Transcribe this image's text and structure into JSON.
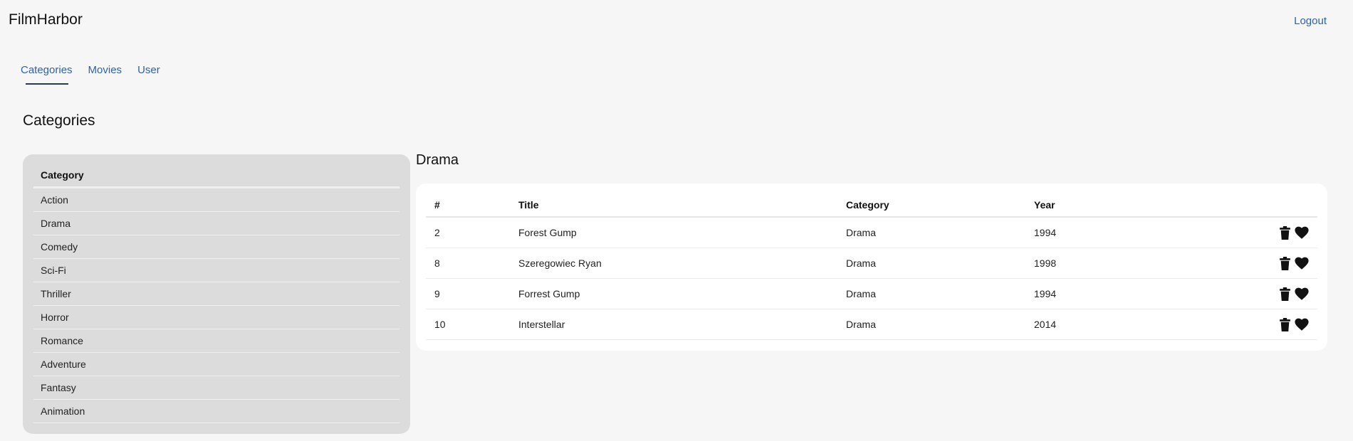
{
  "app": {
    "brand": "FilmHarbor",
    "logout_label": "Logout"
  },
  "nav": {
    "tabs": [
      {
        "label": "Categories",
        "active": true
      },
      {
        "label": "Movies",
        "active": false
      },
      {
        "label": "User",
        "active": false
      }
    ]
  },
  "page": {
    "title": "Categories"
  },
  "categories": {
    "header": "Category",
    "items": [
      "Action",
      "Drama",
      "Comedy",
      "Sci-Fi",
      "Thriller",
      "Horror",
      "Romance",
      "Adventure",
      "Fantasy",
      "Animation"
    ]
  },
  "movies": {
    "selected_category": "Drama",
    "columns": {
      "num": "#",
      "title": "Title",
      "category": "Category",
      "year": "Year"
    },
    "rows": [
      {
        "id": "2",
        "title": "Forest Gump",
        "category": "Drama",
        "year": "1994"
      },
      {
        "id": "8",
        "title": "Szeregowiec Ryan",
        "category": "Drama",
        "year": "1998"
      },
      {
        "id": "9",
        "title": "Forrest Gump",
        "category": "Drama",
        "year": "1994"
      },
      {
        "id": "10",
        "title": "Interstellar",
        "category": "Drama",
        "year": "2014"
      }
    ],
    "row_actions": [
      "trash-icon",
      "heart-icon"
    ]
  },
  "colors": {
    "link": "#2f62a8",
    "background": "#f6f6f6",
    "category_panel": "#dcdcdc",
    "table_panel": "#ffffff"
  }
}
